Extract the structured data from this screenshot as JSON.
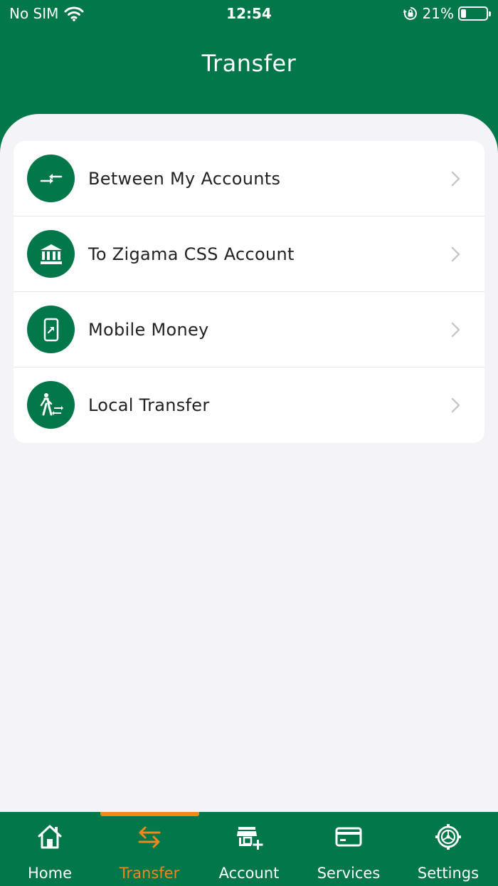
{
  "status_bar": {
    "carrier": "No SIM",
    "time": "12:54",
    "battery_percent_label": "21%",
    "battery_level": 0.21,
    "icons": [
      "wifi-icon",
      "orientation-lock-icon",
      "battery-icon"
    ]
  },
  "header": {
    "title": "Transfer"
  },
  "menu": {
    "items": [
      {
        "label": "Between My Accounts",
        "icon": "arrows-inward-icon"
      },
      {
        "label": "To Zigama CSS Account",
        "icon": "bank-icon"
      },
      {
        "label": "Mobile Money",
        "icon": "mobile-phone-icon"
      },
      {
        "label": "Local Transfer",
        "icon": "person-transfer-icon"
      }
    ]
  },
  "tabbar": {
    "active": "Transfer",
    "tabs": [
      {
        "label": "Home",
        "icon": "home-icon"
      },
      {
        "label": "Transfer",
        "icon": "transfer-arrows-icon"
      },
      {
        "label": "Account",
        "icon": "store-add-icon"
      },
      {
        "label": "Services",
        "icon": "card-icon"
      },
      {
        "label": "Settings",
        "icon": "settings-gear-icon"
      }
    ]
  },
  "colors": {
    "brand_green": "#01774a",
    "accent_orange": "#f0881c",
    "background": "#f3f3f8"
  }
}
